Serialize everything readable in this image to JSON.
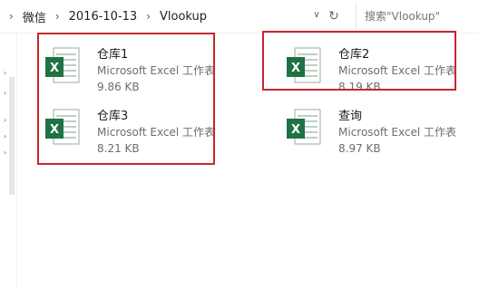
{
  "breadcrumb": {
    "items": [
      "微信",
      "2016-10-13",
      "Vlookup"
    ]
  },
  "search": {
    "placeholder": "搜索\"Vlookup\""
  },
  "files": [
    {
      "name": "仓库1",
      "type": "Microsoft Excel 工作表",
      "size": "9.86 KB"
    },
    {
      "name": "仓库2",
      "type": "Microsoft Excel 工作表",
      "size": "8.19 KB"
    },
    {
      "name": "仓库3",
      "type": "Microsoft Excel 工作表",
      "size": "8.21 KB"
    },
    {
      "name": "查询",
      "type": "Microsoft Excel 工作表",
      "size": "8.97 KB"
    }
  ],
  "icons": {
    "file": "excel-file-icon",
    "refresh": "refresh-icon",
    "dropdown": "chevron-down-icon",
    "separator": "chevron-right-icon"
  },
  "colors": {
    "highlight": "#c8262c",
    "excel_green": "#1f7244"
  }
}
